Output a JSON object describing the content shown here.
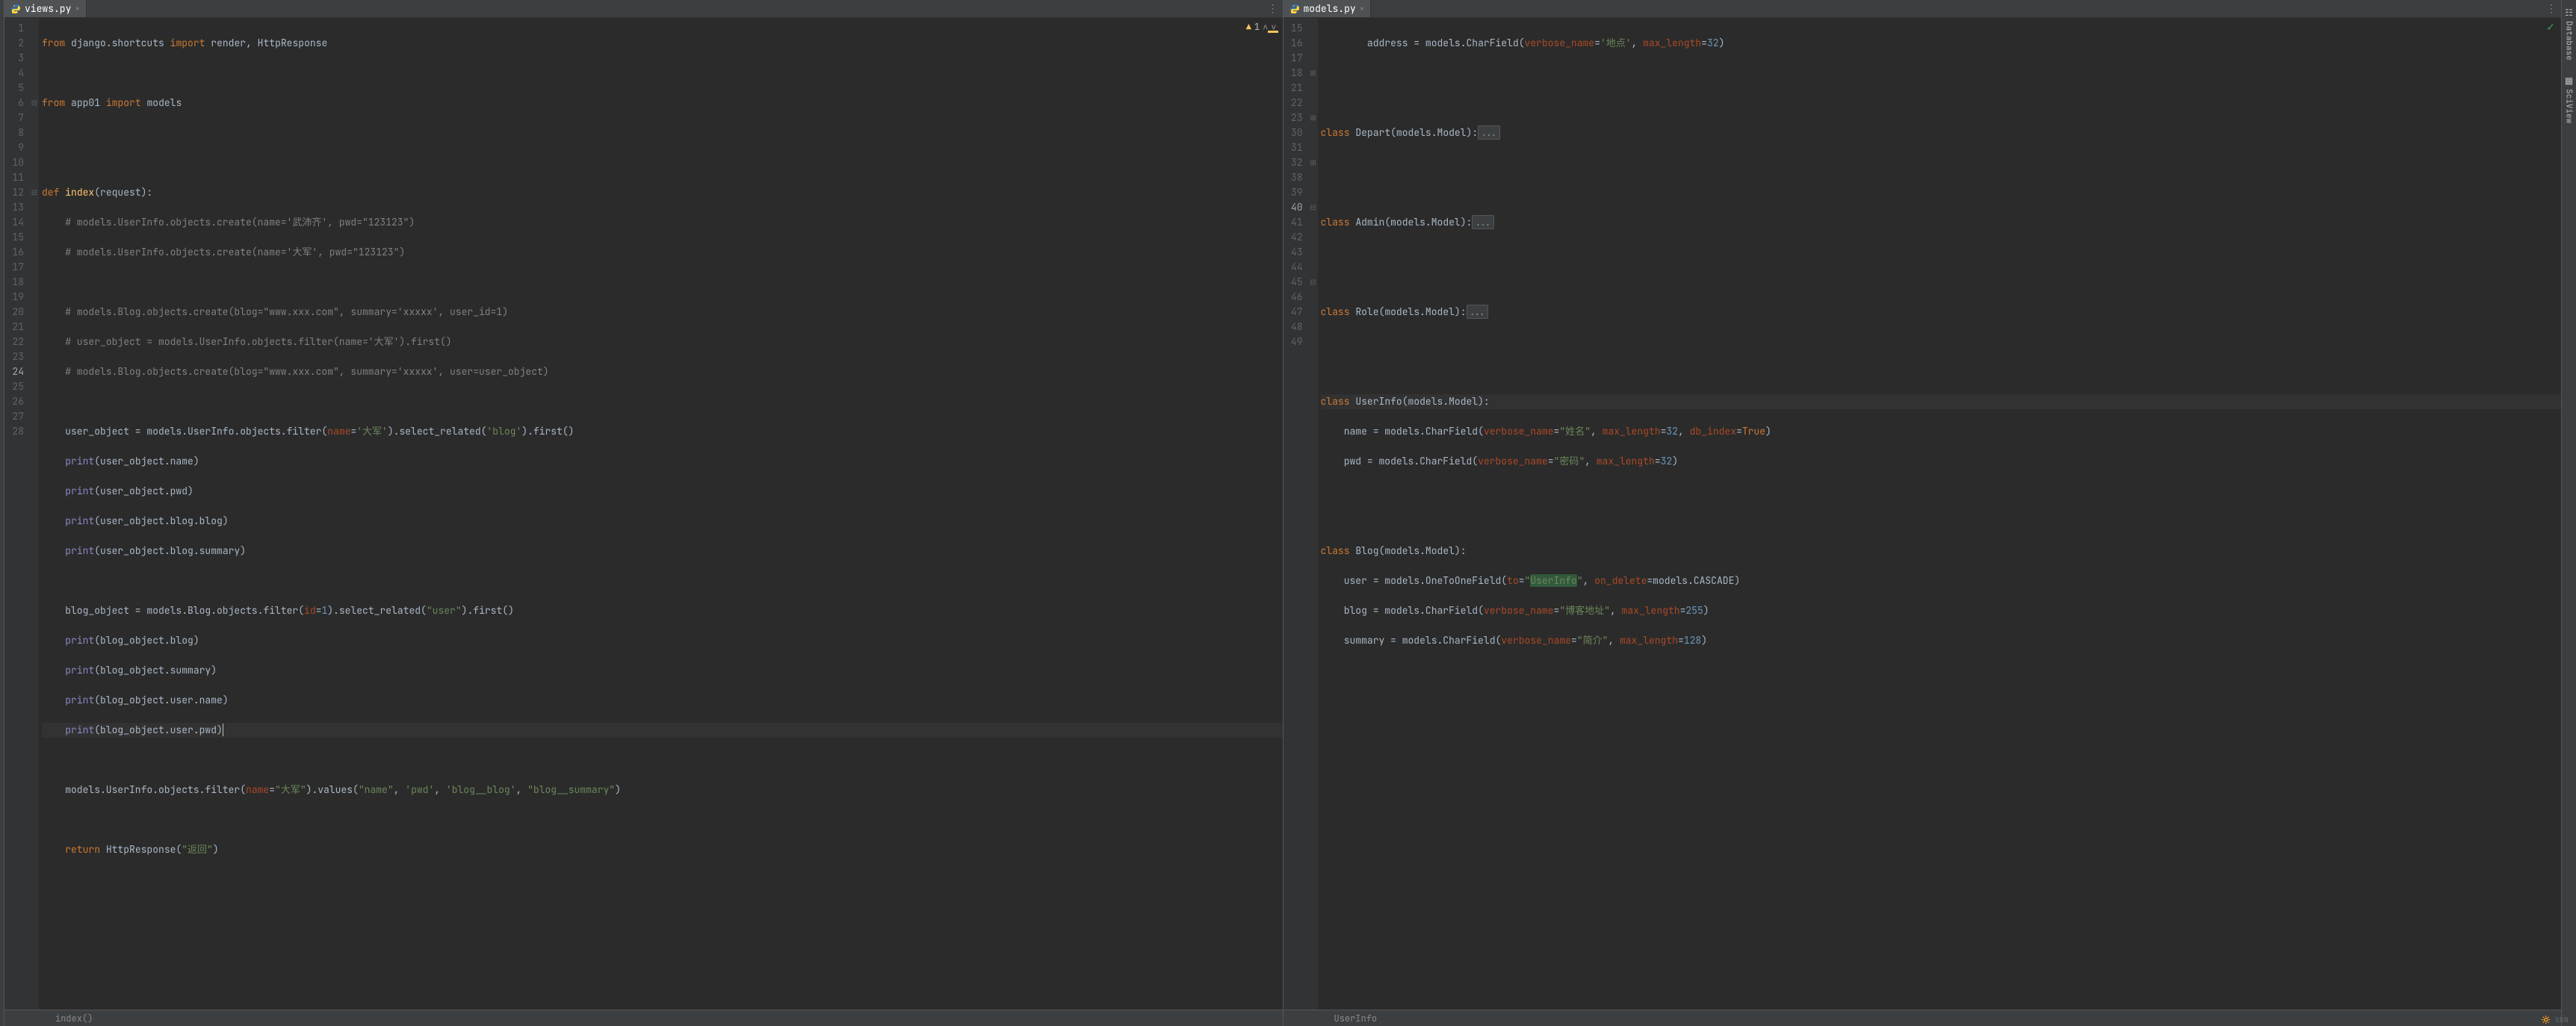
{
  "left_pane": {
    "tab": {
      "filename": "views.py"
    },
    "inspection": {
      "warning_count": "1"
    },
    "breadcrumb": "index()",
    "line_numbers": [
      1,
      2,
      3,
      4,
      5,
      6,
      7,
      8,
      9,
      10,
      11,
      12,
      13,
      14,
      15,
      16,
      17,
      18,
      19,
      20,
      21,
      22,
      23,
      24,
      25,
      26,
      27,
      28
    ],
    "current_line": 24,
    "code": {
      "l1_from": "from",
      "l1_mod": "django.shortcuts",
      "l1_import": "import",
      "l1_names": "render, HttpResponse",
      "l3_from": "from",
      "l3_mod": "app01",
      "l3_import": "import",
      "l3_names": "models",
      "l6_def": "def",
      "l6_name": "index",
      "l6_sig": "(request):",
      "l7": "# models.UserInfo.objects.create(name='武沛齐', pwd=\"123123\")",
      "l8": "# models.UserInfo.objects.create(name='大军', pwd=\"123123\")",
      "l10": "# models.Blog.objects.create(blog=\"www.xxx.com\", summary='xxxxx', user_id=1)",
      "l11": "# user_object = models.UserInfo.objects.filter(name='大军').first()",
      "l12": "# models.Blog.objects.create(blog=\"www.xxx.com\", summary='xxxxx', user=user_object)",
      "l14_a": "user_object = models.UserInfo.objects.filter(",
      "l14_p": "name",
      "l14_b": "=",
      "l14_s": "'大军'",
      "l14_c": ").select_related(",
      "l14_s2": "'blog'",
      "l14_d": ").first()",
      "l15_a": "print",
      "l15_b": "(user_object.name)",
      "l16_a": "print",
      "l16_b": "(user_object.pwd)",
      "l17_a": "print",
      "l17_b": "(user_object.blog.blog)",
      "l18_a": "print",
      "l18_b": "(user_object.blog.summary)",
      "l20_a": "blog_object = models.Blog.objects.filter(",
      "l20_p": "id",
      "l20_b": "=",
      "l20_n": "1",
      "l20_c": ").select_related(",
      "l20_s": "\"user\"",
      "l20_d": ").first()",
      "l21_a": "print",
      "l21_b": "(blog_object.blog)",
      "l22_a": "print",
      "l22_b": "(blog_object.summary)",
      "l23_a": "print",
      "l23_b": "(blog_object.user.name)",
      "l24_a": "print",
      "l24_b": "(blog_object.user.pwd)",
      "l26_a": "models.UserInfo.objects.filter(",
      "l26_p": "name",
      "l26_b": "=",
      "l26_s1": "\"大军\"",
      "l26_c": ").values(",
      "l26_s2": "\"name\"",
      "l26_d": ", ",
      "l26_s3": "'pwd'",
      "l26_e": ", ",
      "l26_s4": "'blog__blog'",
      "l26_f": ", ",
      "l26_s5": "\"blog__summary\"",
      "l26_g": ")",
      "l28_ret": "return",
      "l28_a": " HttpResponse(",
      "l28_s": "\"返回\"",
      "l28_b": ")"
    }
  },
  "right_pane": {
    "tab": {
      "filename": "models.py"
    },
    "breadcrumb": "UserInfo",
    "line_numbers": [
      15,
      16,
      17,
      18,
      21,
      22,
      23,
      30,
      31,
      32,
      38,
      39,
      40,
      41,
      42,
      43,
      44,
      45,
      46,
      47,
      48,
      49
    ],
    "current_line": 40,
    "code": {
      "l15_a": "address = models.CharField(",
      "l15_p1": "verbose_name",
      "l15_b": "=",
      "l15_s": "'地点'",
      "l15_c": ", ",
      "l15_p2": "max_length",
      "l15_d": "=",
      "l15_n": "32",
      "l15_e": ")",
      "l18_cls": "class",
      "l18_name": " Depart(models.Model):",
      "l18_fold": "...",
      "l23_cls": "class",
      "l23_name": " Admin(models.Model):",
      "l23_fold": "...",
      "l32_cls": "class",
      "l32_name": " Role(models.Model):",
      "l32_fold": "...",
      "l40_cls": "class",
      "l40_name": " UserInfo(models.Model):",
      "l41_a": "name = models.CharField(",
      "l41_p1": "verbose_name",
      "l41_b": "=",
      "l41_s": "\"姓名\"",
      "l41_c": ", ",
      "l41_p2": "max_length",
      "l41_d": "=",
      "l41_n1": "32",
      "l41_e": ", ",
      "l41_p3": "db_index",
      "l41_f": "=",
      "l41_t": "True",
      "l41_g": ")",
      "l42_a": "pwd = models.CharField(",
      "l42_p1": "verbose_name",
      "l42_b": "=",
      "l42_s": "\"密码\"",
      "l42_c": ", ",
      "l42_p2": "max_length",
      "l42_d": "=",
      "l42_n": "32",
      "l42_e": ")",
      "l45_cls": "class",
      "l45_name": " Blog(models.Model):",
      "l46_a": "user = models.OneToOneField(",
      "l46_p1": "to",
      "l46_b": "=",
      "l46_s": "\"UserInfo\"",
      "l46_c": ", ",
      "l46_p2": "on_delete",
      "l46_d": "=models.CASCADE)",
      "l47_a": "blog = models.CharField(",
      "l47_p1": "verbose_name",
      "l47_b": "=",
      "l47_s": "\"博客地址\"",
      "l47_c": ", ",
      "l47_p2": "max_length",
      "l47_d": "=",
      "l47_n": "255",
      "l47_e": ")",
      "l48_a": "summary = models.CharField(",
      "l48_p1": "verbose_name",
      "l48_b": "=",
      "l48_s": "\"简介\"",
      "l48_c": ", ",
      "l48_p2": "max_length",
      "l48_d": "=",
      "l48_n": "128",
      "l48_e": ")"
    }
  },
  "right_tabs": {
    "database": "Database",
    "sciview": "SciView"
  }
}
